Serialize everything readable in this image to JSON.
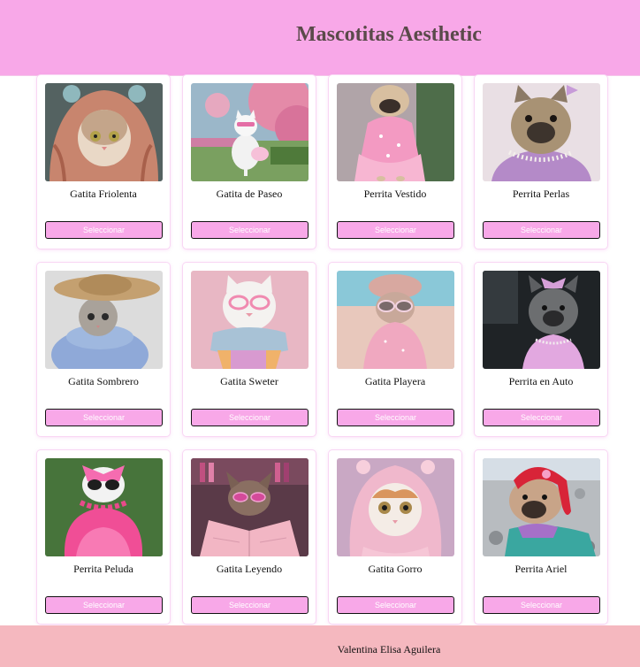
{
  "header": {
    "title": "Mascotitas Aesthetic"
  },
  "pets": [
    {
      "name": "Gatita Friolenta",
      "button": "Seleccionar",
      "image": "cat-in-knitted-hood-image"
    },
    {
      "name": "Gatita de Paseo",
      "button": "Seleccionar",
      "image": "cat-in-garden-image"
    },
    {
      "name": "Perrita Vestido",
      "button": "Seleccionar",
      "image": "pug-in-pink-dress-image"
    },
    {
      "name": "Perrita Perlas",
      "button": "Seleccionar",
      "image": "bulldog-with-pearls-image"
    },
    {
      "name": "Gatita Sombrero",
      "button": "Seleccionar",
      "image": "cat-with-straw-hat-image"
    },
    {
      "name": "Gatita Sweter",
      "button": "Seleccionar",
      "image": "cat-in-scarf-image"
    },
    {
      "name": "Gatita Playera",
      "button": "Seleccionar",
      "image": "cat-on-beach-image"
    },
    {
      "name": "Perrita en Auto",
      "button": "Seleccionar",
      "image": "bulldog-in-car-image"
    },
    {
      "name": "Perrita Peluda",
      "button": "Seleccionar",
      "image": "dog-in-pink-fluff-image"
    },
    {
      "name": "Gatita Leyendo",
      "button": "Seleccionar",
      "image": "cat-reading-book-image"
    },
    {
      "name": "Gatita Gorro",
      "button": "Seleccionar",
      "image": "cat-in-pink-hood-image"
    },
    {
      "name": "Perrita Ariel",
      "button": "Seleccionar",
      "image": "bulldog-mermaid-costume-image"
    }
  ],
  "footer": {
    "text": "Valentina Elisa Aguilera"
  }
}
